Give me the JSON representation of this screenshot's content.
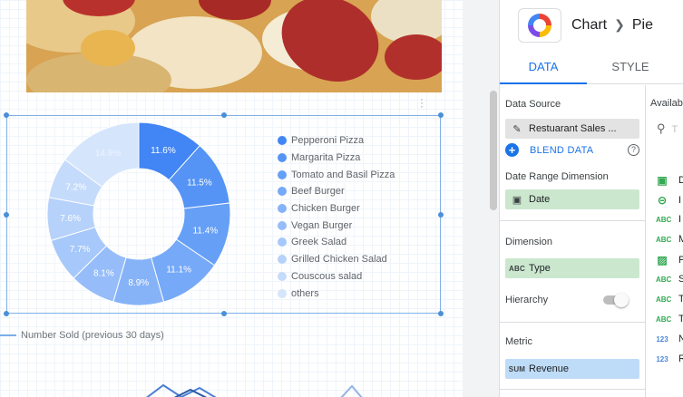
{
  "chart": {
    "type": "pie",
    "series_label": "Number Sold (previous 30 days)",
    "slices": [
      {
        "label": "Pepperoni Pizza",
        "value_label": "11.6%",
        "value": 11.6,
        "color": "#4285f4"
      },
      {
        "label": "Margarita Pizza",
        "value_label": "11.5%",
        "value": 11.5,
        "color": "#5594f5"
      },
      {
        "label": "Tomato and Basil Pizza",
        "value_label": "11.4%",
        "value": 11.4,
        "color": "#669ff6"
      },
      {
        "label": "Beef Burger",
        "value_label": "11.1%",
        "value": 11.1,
        "color": "#76a9f7"
      },
      {
        "label": "Chicken Burger",
        "value_label": "8.9%",
        "value": 8.9,
        "color": "#86b3f8"
      },
      {
        "label": "Vegan Burger",
        "value_label": "8.1%",
        "value": 8.1,
        "color": "#96bdf9"
      },
      {
        "label": "Greek Salad",
        "value_label": "7.7%",
        "value": 7.7,
        "color": "#a6c8fa"
      },
      {
        "label": "Grilled Chicken Salad",
        "value_label": "7.6%",
        "value": 7.6,
        "color": "#b6d2fb"
      },
      {
        "label": "Couscous salad",
        "value_label": "7.2%",
        "value": 7.2,
        "color": "#c5dbfb"
      },
      {
        "label": "others",
        "value_label": "14.9%",
        "value": 14.9,
        "color": "#d5e5fc"
      }
    ]
  },
  "panel": {
    "breadcrumb": [
      "Chart",
      "Pie"
    ],
    "tabs": [
      "DATA",
      "STYLE"
    ],
    "active_tab": "DATA",
    "data_source_title": "Data Source",
    "data_source_value": "Restuarant Sales ...",
    "blend_label": "BLEND DATA",
    "date_range_title": "Date Range Dimension",
    "date_value": "Date",
    "dimension_title": "Dimension",
    "dimension_value": "Type",
    "hierarchy_title": "Hierarchy",
    "hierarchy_on": false,
    "metric_title": "Metric",
    "metric_agg": "SUM",
    "metric_value": "Revenue",
    "available_title": "Availab",
    "search_placeholder": "T",
    "available_fields": [
      {
        "icon": "calendar-icon",
        "type_label": "",
        "name": "D",
        "color": "#34a853"
      },
      {
        "icon": "link-icon",
        "type_label": "",
        "name": "I",
        "color": "#34a853"
      },
      {
        "icon": "text-type-icon",
        "type_label": "ABC",
        "name": "I",
        "color": "#34a853"
      },
      {
        "icon": "text-type-icon",
        "type_label": "ABC",
        "name": "M",
        "color": "#34a853"
      },
      {
        "icon": "image-icon",
        "type_label": "",
        "name": "P",
        "color": "#34a853"
      },
      {
        "icon": "text-type-icon",
        "type_label": "ABC",
        "name": "S",
        "color": "#34a853"
      },
      {
        "icon": "text-type-icon",
        "type_label": "ABC",
        "name": "T",
        "color": "#34a853"
      },
      {
        "icon": "text-type-icon",
        "type_label": "ABC",
        "name": "T",
        "color": "#34a853"
      },
      {
        "icon": "number-type-icon",
        "type_label": "123",
        "name": "N",
        "color": "#4a86d8"
      },
      {
        "icon": "number-type-icon",
        "type_label": "123",
        "name": "R",
        "color": "#4a86d8"
      }
    ]
  }
}
